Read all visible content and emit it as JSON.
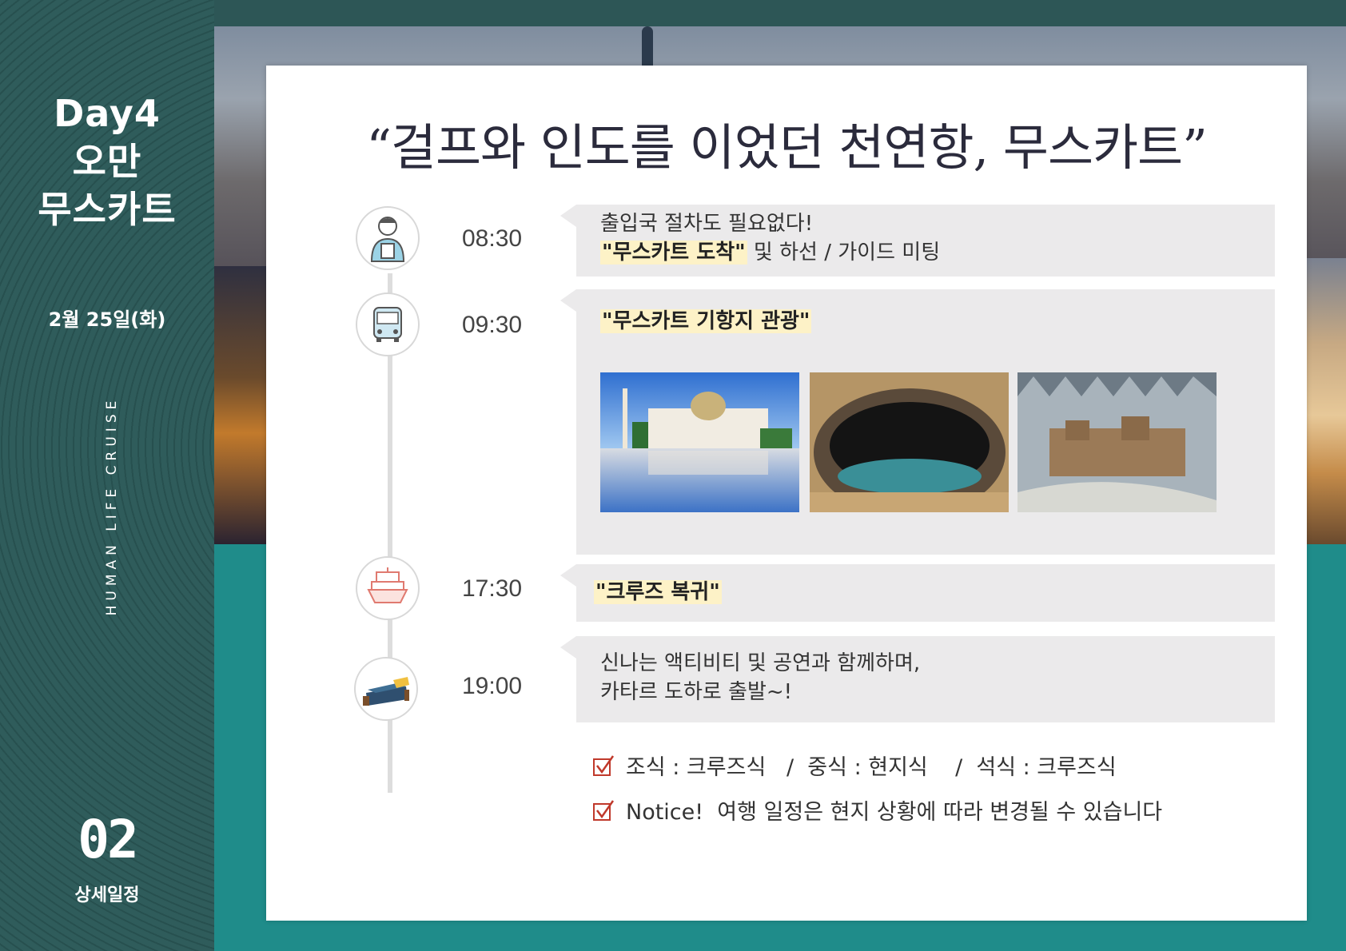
{
  "sidebar": {
    "day": "Day4",
    "country": "오만",
    "city": "무스카트",
    "date": "2월 25일(화)",
    "brand": "HUMAN LIFE CRUISE",
    "page_number": "02",
    "section": "상세일정"
  },
  "headline": "“걸프와 인도를 이었던 천연항, 무스카트”",
  "schedule": [
    {
      "time": "08:30",
      "icon": "guide-person-icon",
      "line1": "출입국 절차도 필요없다!",
      "highlight": "\"무스카트 도착\"",
      "rest": " 및 하선 / 가이드 미팅"
    },
    {
      "time": "09:30",
      "icon": "bus-icon",
      "highlight": "\"무스카트 기항지 관광\""
    },
    {
      "time": "17:30",
      "icon": "cruise-ship-icon",
      "highlight": "\"크루즈 복귀\""
    },
    {
      "time": "19:00",
      "icon": "bed-icon",
      "line1": "신나는 액티비티 및 공연과 함께하며,",
      "line2": "카타르 도하로 출발~!"
    }
  ],
  "photos": [
    {
      "icon": "grand-mosque-photo"
    },
    {
      "icon": "sinkhole-lagoon-photo"
    },
    {
      "icon": "mountain-village-model-photo"
    }
  ],
  "meals": "조식 : 크루즈식   /  중식 : 현지식    /  석식 : 크루즈식",
  "notice": "Notice!  여행 일정은 현지 상황에 따라 변경될 수 있습니다",
  "colors": {
    "sidebar": "#2a5453",
    "teal": "#1f8c8a",
    "bubble": "#ebeaeb",
    "highlight": "#fdf2c7",
    "check_red": "#c0392b"
  }
}
